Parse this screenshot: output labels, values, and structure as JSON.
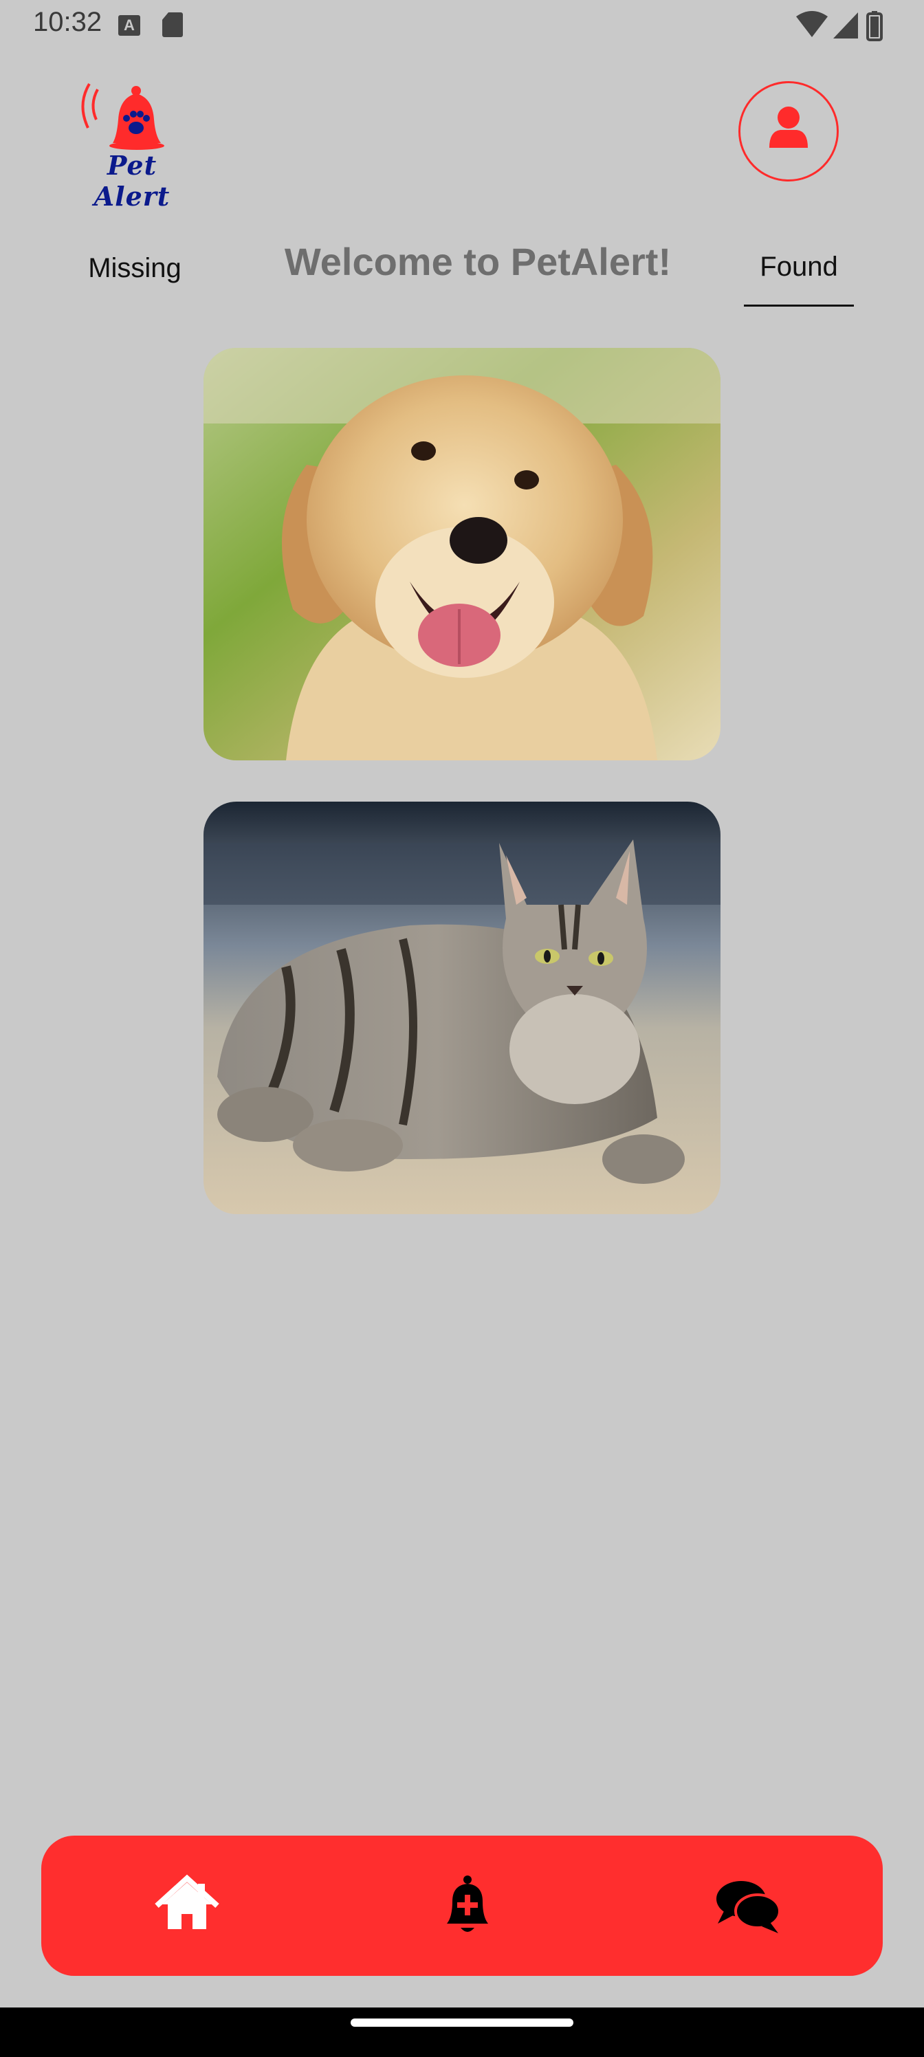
{
  "status_bar": {
    "time": "10:32",
    "left_icons": [
      "text-a-icon",
      "sd-card-icon"
    ],
    "right_icons": [
      "wifi-icon",
      "signal-icon",
      "battery-icon"
    ]
  },
  "header": {
    "logo_text": "Pet Alert",
    "profile_icon": "user-icon"
  },
  "tabs": {
    "missing_label": "Missing",
    "title": "Welcome to PetAlert!",
    "found_label": "Found",
    "selected": "Found"
  },
  "pets": [
    {
      "kind": "dog",
      "image": "golden-retriever-photo"
    },
    {
      "kind": "cat",
      "image": "tabby-cat-photo"
    }
  ],
  "bottom_nav": {
    "items": [
      "home-icon",
      "add-alert-icon",
      "chat-icon"
    ]
  },
  "colors": {
    "background": "#c9c9c9",
    "accent": "#ff2e2e",
    "logo_text": "#0b1a8c",
    "title": "#6e6e6e"
  }
}
